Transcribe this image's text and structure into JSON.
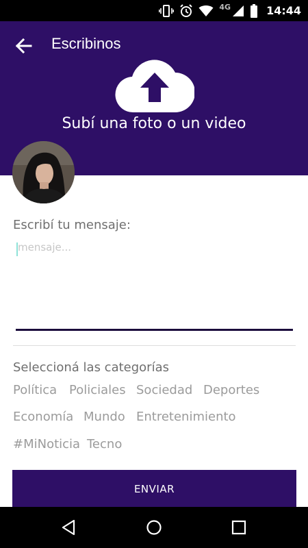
{
  "status_bar": {
    "time": "14:44",
    "network": "4G"
  },
  "header": {
    "title": "Escribinos",
    "upload_label": "Subí una foto o un video"
  },
  "message": {
    "label": "Escribí tu mensaje:",
    "placeholder": "mensaje...",
    "value": ""
  },
  "categories": {
    "label": "Seleccioná las categorías",
    "items": [
      "Política",
      "Policiales",
      "Sociedad",
      "Deportes",
      "Economía",
      "Mundo",
      "Entretenimiento",
      "#MiNoticia",
      "Tecno"
    ]
  },
  "submit": {
    "label": "ENVIAR"
  },
  "colors": {
    "primary": "#2e0f66",
    "underline": "#1a0a3c",
    "label_text": "#6f6f6f",
    "chip_text": "#9b9b9b"
  }
}
